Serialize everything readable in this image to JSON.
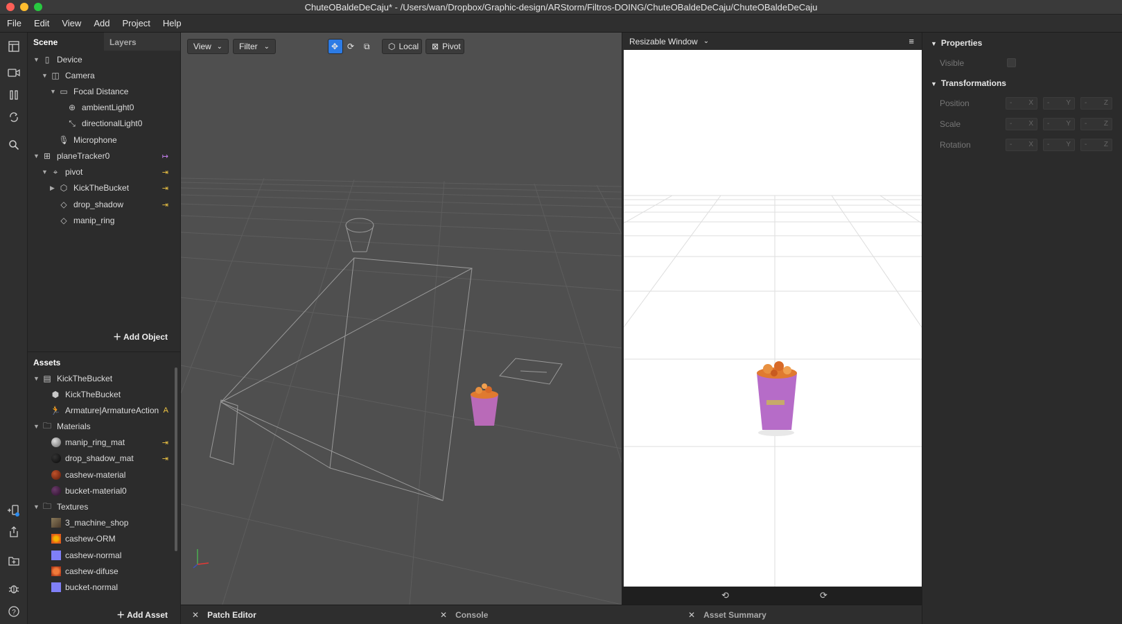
{
  "window": {
    "title": "ChuteOBaldeDeCaju* - /Users/wan/Dropbox/Graphic-design/ARStorm/Filtros-DOING/ChuteOBaldeDeCaju/ChuteOBaldeDeCaju"
  },
  "menu": [
    "File",
    "Edit",
    "View",
    "Add",
    "Project",
    "Help"
  ],
  "scene": {
    "tabs": [
      "Scene",
      "Layers"
    ],
    "items": [
      {
        "label": "Device"
      },
      {
        "label": "Camera"
      },
      {
        "label": "Focal Distance"
      },
      {
        "label": "ambientLight0"
      },
      {
        "label": "directionalLight0"
      },
      {
        "label": "Microphone"
      },
      {
        "label": "planeTracker0"
      },
      {
        "label": "pivot"
      },
      {
        "label": "KickTheBucket"
      },
      {
        "label": "drop_shadow"
      },
      {
        "label": "manip_ring"
      }
    ],
    "add_object": "Add Object"
  },
  "assets": {
    "title": "Assets",
    "items": [
      {
        "label": "KickTheBucket"
      },
      {
        "label": "KickTheBucket"
      },
      {
        "label": "Armature|ArmatureAction",
        "badge": "A"
      },
      {
        "label": "Materials"
      },
      {
        "label": "manip_ring_mat"
      },
      {
        "label": "drop_shadow_mat"
      },
      {
        "label": "cashew-material"
      },
      {
        "label": "bucket-material0"
      },
      {
        "label": "Textures"
      },
      {
        "label": "3_machine_shop"
      },
      {
        "label": "cashew-ORM"
      },
      {
        "label": "cashew-normal"
      },
      {
        "label": "cashew-difuse"
      },
      {
        "label": "bucket-normal"
      }
    ],
    "add_asset": "Add Asset"
  },
  "viewport": {
    "view_label": "View",
    "filter_label": "Filter",
    "local_label": "Local",
    "pivot_label": "Pivot"
  },
  "simulator": {
    "device_label": "Resizable Window"
  },
  "properties": {
    "title": "Properties",
    "visible_label": "Visible",
    "transform_title": "Transformations",
    "position_label": "Position",
    "scale_label": "Scale",
    "rotation_label": "Rotation",
    "field_value": "-",
    "axes": [
      "X",
      "Y",
      "Z"
    ]
  },
  "bottom": {
    "tabs": [
      "Patch Editor",
      "Console",
      "Asset Summary"
    ]
  }
}
